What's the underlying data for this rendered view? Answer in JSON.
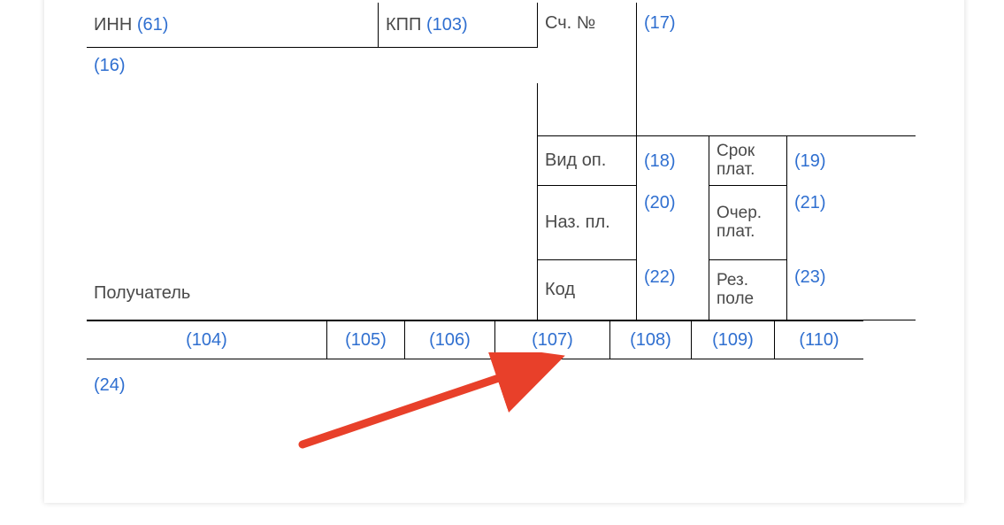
{
  "top": {
    "inn_label": "ИНН",
    "inn_code": "(61)",
    "kpp_label": "КПП",
    "kpp_code": "(103)",
    "sch_label": "Сч. №",
    "c17": "(17)"
  },
  "c16": "(16)",
  "recipient_label": "Получатель",
  "grid": {
    "vop": "Вид оп.",
    "napl": "Наз. пл.",
    "kod": "Код",
    "srok": "Срок плат.",
    "ocher": "Очер. плат.",
    "rez": "Рез. поле",
    "c18": "(18)",
    "c19": "(19)",
    "c20": "(20)",
    "c21": "(21)",
    "c22": "(22)",
    "c23": "(23)"
  },
  "strip": {
    "c104": "(104)",
    "c105": "(105)",
    "c106": "(106)",
    "c107": "(107)",
    "c108": "(108)",
    "c109": "(109)",
    "c110": "(110)"
  },
  "c24": "(24)",
  "colors": {
    "link": "#2f6fd0",
    "arrow": "#e8402a"
  }
}
